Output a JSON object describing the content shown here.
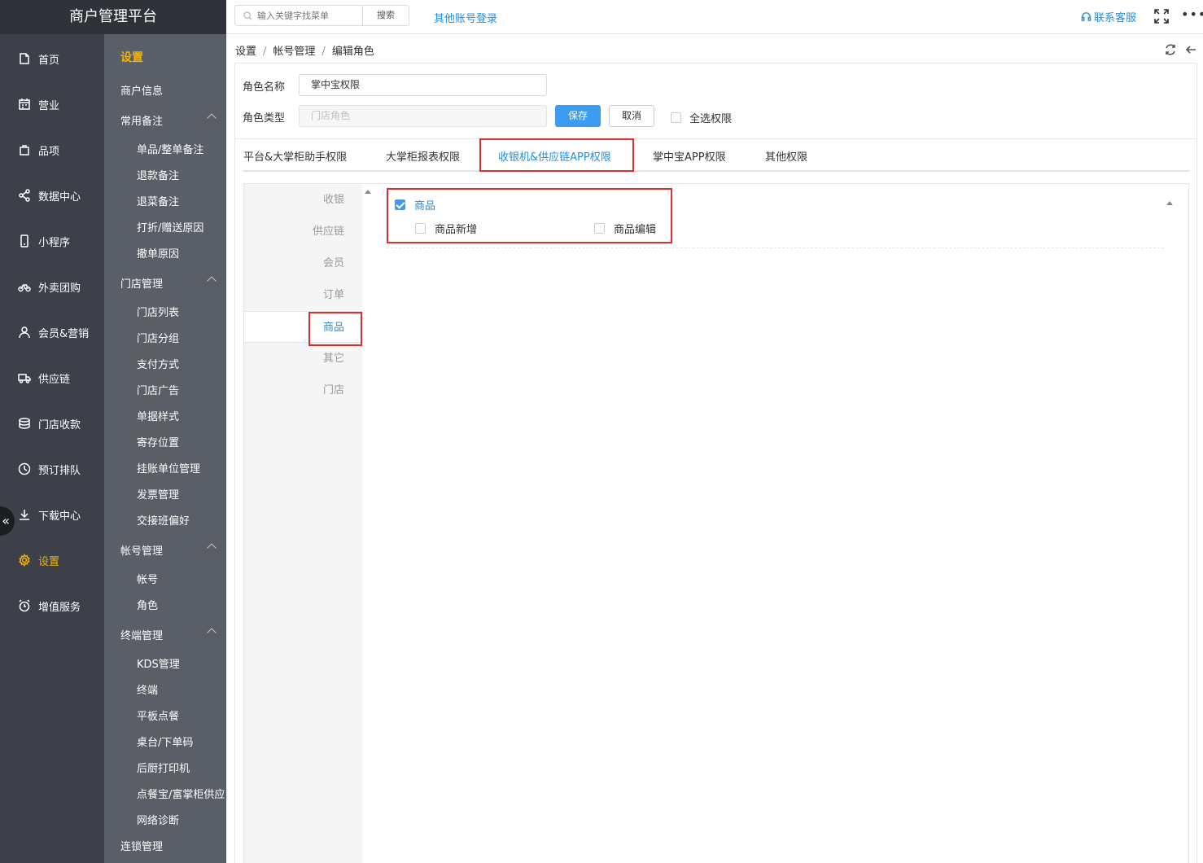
{
  "brand": {
    "title": "商户管理平台"
  },
  "left_nav": {
    "items": [
      {
        "label": "首页",
        "icon": "home-icon"
      },
      {
        "label": "营业",
        "icon": "calendar-icon"
      },
      {
        "label": "品项",
        "icon": "bag-icon"
      },
      {
        "label": "数据中心",
        "icon": "share-icon"
      },
      {
        "label": "小程序",
        "icon": "phone-icon"
      },
      {
        "label": "外卖团购",
        "icon": "bike-icon"
      },
      {
        "label": "会员&营销",
        "icon": "user-icon"
      },
      {
        "label": "供应链",
        "icon": "truck-icon"
      },
      {
        "label": "门店收款",
        "icon": "coins-icon"
      },
      {
        "label": "预订排队",
        "icon": "clock-icon"
      },
      {
        "label": "下载中心",
        "icon": "download-icon"
      },
      {
        "label": "设置",
        "icon": "gear-icon",
        "active": true
      },
      {
        "label": "增值服务",
        "icon": "alarm-icon"
      }
    ],
    "collapse_glyph": "«"
  },
  "sub_nav": {
    "title": "设置",
    "merchant_info": "商户信息",
    "groups": [
      {
        "label": "常用备注",
        "items": [
          "单品/整单备注",
          "退款备注",
          "退菜备注",
          "打折/赠送原因",
          "撤单原因"
        ]
      },
      {
        "label": "门店管理",
        "items": [
          "门店列表",
          "门店分组",
          "支付方式",
          "门店广告",
          "单据样式",
          "寄存位置",
          "挂账单位管理",
          "发票管理",
          "交接班偏好"
        ]
      },
      {
        "label": "帐号管理",
        "items": [
          "帐号",
          "角色"
        ]
      },
      {
        "label": "终端管理",
        "items": [
          "KDS管理",
          "终端",
          "平板点餐",
          "桌台/下单码",
          "后厨打印机",
          "点餐宝/富掌柜供应",
          "网络诊断"
        ]
      }
    ],
    "chain_management": "连锁管理"
  },
  "topbar": {
    "search_placeholder": "输入关键字找菜单",
    "search_button": "搜索",
    "other_login": "其他账号登录",
    "contact": "联系客服",
    "more": "•••"
  },
  "breadcrumb": [
    "设置",
    "帐号管理",
    "编辑角色"
  ],
  "form": {
    "role_name_label": "角色名称",
    "role_name_value": "掌中宝权限",
    "role_type_label": "角色类型",
    "role_type_placeholder": "门店角色",
    "save": "保存",
    "cancel": "取消",
    "select_all": "全选权限"
  },
  "tabs": [
    {
      "label": "平台&大掌柜助手权限"
    },
    {
      "label": "大掌柜报表权限"
    },
    {
      "label": "收银机&供应链APP权限",
      "active": true
    },
    {
      "label": "掌中宝APP权限"
    },
    {
      "label": "其他权限"
    }
  ],
  "perm_categories": [
    "收银",
    "供应链",
    "会员",
    "订单",
    "商品",
    "其它",
    "门店"
  ],
  "perm_active_category": "商品",
  "perm_group": {
    "label": "商品",
    "checked": true,
    "children": [
      {
        "label": "商品新增",
        "checked": false
      },
      {
        "label": "商品编辑",
        "checked": false
      }
    ]
  },
  "colors": {
    "accent": "#1e8fe0",
    "active_nav": "#f5b400",
    "highlight": "#e32b2b",
    "primary_button": "#3c9cf2"
  }
}
